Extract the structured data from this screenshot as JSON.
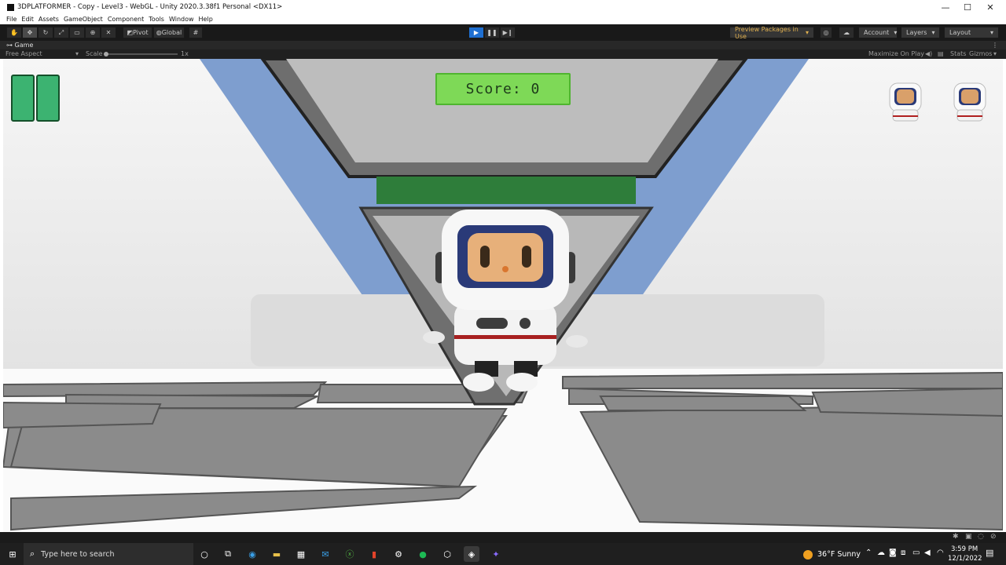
{
  "window": {
    "title": "3DPLATFORMER - Copy - Level3 - WebGL - Unity 2020.3.38f1 Personal <DX11>"
  },
  "menu": {
    "items": [
      "File",
      "Edit",
      "Assets",
      "GameObject",
      "Component",
      "Tools",
      "Window",
      "Help"
    ]
  },
  "toolbar": {
    "pivot_label": "Pivot",
    "global_label": "Global",
    "preview_packages_label": "Preview Packages in Use",
    "account_label": "Account",
    "layers_label": "Layers",
    "layout_label": "Layout"
  },
  "game_tab": {
    "tab_label": "Game",
    "aspect": "Free Aspect",
    "scale_label": "Scale",
    "scale_value": "1x",
    "maximize_label": "Maximize On Play",
    "stats_label": "Stats",
    "gizmos_label": "Gizmos"
  },
  "hud": {
    "score_text": "Score: 0",
    "lives": 2,
    "pause_paused": false
  },
  "taskbar": {
    "search_placeholder": "Type here to search",
    "weather": "36°F  Sunny",
    "time": "3:59 PM",
    "date": "12/1/2022"
  },
  "colors": {
    "accent_play": "#1f6fd1",
    "score_bg": "#7ed957",
    "pause_green": "#3cb371",
    "preview_packages": "#e0b050"
  }
}
